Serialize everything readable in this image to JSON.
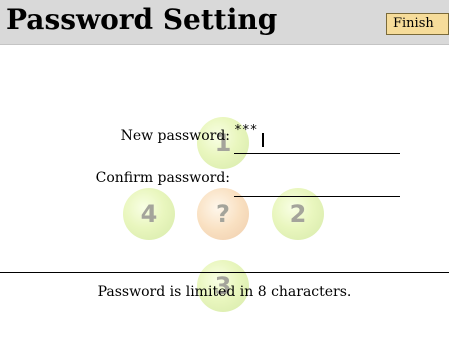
{
  "header": {
    "title": "Password Setting",
    "finish_label": "Finish"
  },
  "form": {
    "new_password_label": "New password:",
    "new_password_value": "***",
    "confirm_password_label": "Confirm password:",
    "confirm_password_value": ""
  },
  "dpad": {
    "up_key": "1",
    "left_key": "4",
    "center_key": "?",
    "right_key": "2",
    "down_key": "3"
  },
  "footer": {
    "hint": "Password is limited in 8 characters."
  },
  "colors": {
    "header_bg": "#d9d9d9",
    "finish_button_bg": "#f6dc9a",
    "dpad_green": "#d8f08a",
    "dpad_orange": "#f5c890"
  }
}
